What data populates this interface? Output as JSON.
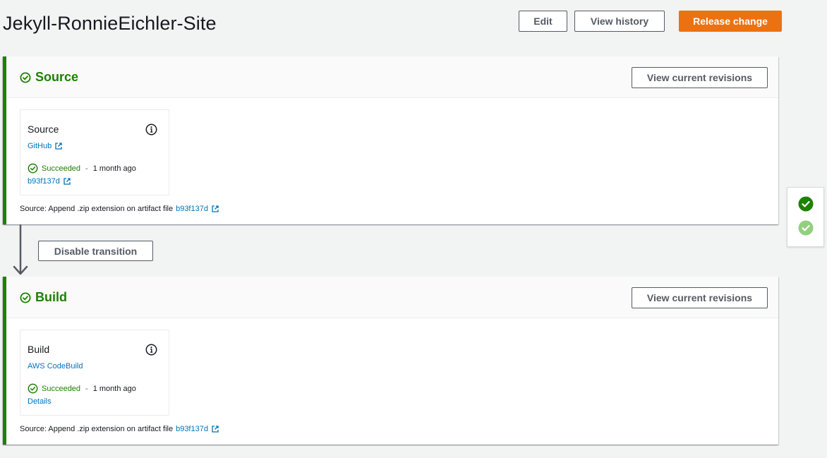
{
  "page": {
    "title": "Jekyll-RonnieEichler-Site"
  },
  "header_buttons": {
    "edit": "Edit",
    "view_history": "View history",
    "release_change": "Release change"
  },
  "colors": {
    "success": "#1d8102",
    "link": "#0073bb",
    "primary": "#ec7211",
    "success_light": "#93cf7f"
  },
  "stages": [
    {
      "name": "Source",
      "revisions_button": "View current revisions",
      "action": {
        "name": "Source",
        "provider": "GitHub",
        "status": "Succeeded",
        "separator": "-",
        "time": "1 month ago",
        "detail": "b93f137d"
      },
      "footer": {
        "label": "Source: Append .zip extension on artifact file",
        "link": "b93f137d"
      }
    },
    {
      "name": "Build",
      "revisions_button": "View current revisions",
      "action": {
        "name": "Build",
        "provider": "AWS CodeBuild",
        "status": "Succeeded",
        "separator": "-",
        "time": "1 month ago",
        "detail": "Details"
      },
      "footer": {
        "label": "Source: Append .zip extension on artifact file",
        "link": "b93f137d"
      }
    }
  ],
  "transition": {
    "button": "Disable transition"
  },
  "side_panel": {
    "icons": [
      "check-circle-filled-icon",
      "check-circle-light-icon"
    ]
  }
}
